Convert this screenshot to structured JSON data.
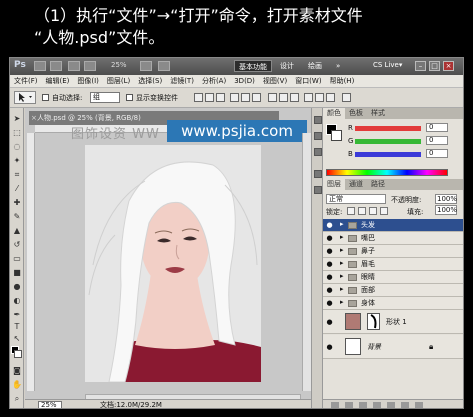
{
  "caption": {
    "line1": "（1）执行“文件”→“打开”命令，打开素材文件",
    "line2": "“人物.psd”文件。"
  },
  "titlebar": {
    "app_icon": "Ps",
    "zoom": "25%",
    "workspaces": [
      "基本功能",
      "设计",
      "绘画"
    ],
    "more": "»",
    "cs_live": "CS Live▾",
    "window_buttons": [
      "–",
      "□",
      "×"
    ]
  },
  "menubar": {
    "items": [
      "文件(F)",
      "编辑(E)",
      "图像(I)",
      "图层(L)",
      "选择(S)",
      "滤镜(T)",
      "分析(A)",
      "3D(D)",
      "视图(V)",
      "窗口(W)",
      "帮助(H)"
    ]
  },
  "options": {
    "auto_select_label": "自动选择:",
    "auto_select_value": "组",
    "show_transform_label": "显示变换控件"
  },
  "document": {
    "tab_title": "人物.psd @ 25% (背景, RGB/8)",
    "tab_close": "×",
    "watermark_text": "图饰设资 WW",
    "watermark_url": "www.psjia.com",
    "zoom": "25%",
    "doc_info": "文档:12.0M/29.2M"
  },
  "color_panel": {
    "tabs": [
      "颜色",
      "色板",
      "样式"
    ],
    "channels": [
      {
        "label": "R",
        "value": "0",
        "color": "#e23b3b"
      },
      {
        "label": "G",
        "value": "0",
        "color": "#36b836"
      },
      {
        "label": "B",
        "value": "0",
        "color": "#3a3ad8"
      }
    ]
  },
  "layers_panel": {
    "tabs": [
      "图层",
      "通道",
      "路径"
    ],
    "blend_mode": "正常",
    "opacity_label": "不透明度:",
    "opacity": "100%",
    "lock_label": "锁定:",
    "fill_label": "填充:",
    "fill": "100%",
    "layers": [
      {
        "name": "头发",
        "type": "group",
        "selected": true
      },
      {
        "name": "嘴巴",
        "type": "group",
        "selected": false
      },
      {
        "name": "鼻子",
        "type": "group",
        "selected": false
      },
      {
        "name": "眉毛",
        "type": "group",
        "selected": false
      },
      {
        "name": "眼睛",
        "type": "group",
        "selected": false
      },
      {
        "name": "面部",
        "type": "group",
        "selected": false
      },
      {
        "name": "身体",
        "type": "group",
        "selected": false
      },
      {
        "name": "形状 1",
        "type": "shape",
        "thumb_color": "#b07a74"
      },
      {
        "name": "背景",
        "type": "background",
        "thumb_color": "#ffffff"
      }
    ]
  },
  "colors": {
    "ui_grey": "#d4d0c8",
    "selection_blue": "#2d4f8f",
    "watermark_blue": "#2c77b5",
    "skin": "#f2cfc6",
    "dress": "#8a1931"
  }
}
